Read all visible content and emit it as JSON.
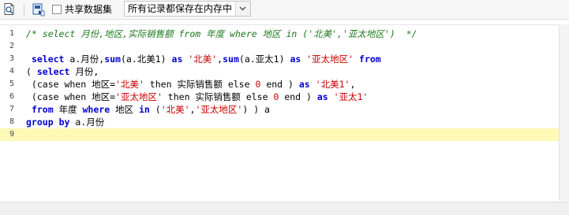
{
  "toolbar": {
    "query_icon": "magnifier-page-icon",
    "export_icon": "export-icon",
    "share_checkbox_label": "共享数据集",
    "share_checked": false,
    "record_mode_value": "所有记录都保存在内存中"
  },
  "editor": {
    "active_line": 9,
    "lines": [
      {
        "n": "1",
        "tokens": [
          {
            "t": "cmt",
            "v": "/* select 月份,地区,实际销售额 from 年度 where 地区 in ('北美','亚太地区')  */"
          }
        ]
      },
      {
        "n": "2",
        "tokens": []
      },
      {
        "n": "3",
        "tokens": [
          {
            "t": "txt",
            "v": " "
          },
          {
            "t": "kw",
            "v": "select"
          },
          {
            "t": "txt",
            "v": " a.月份,"
          },
          {
            "t": "kw",
            "v": "sum"
          },
          {
            "t": "txt",
            "v": "(a.北美1) "
          },
          {
            "t": "kw",
            "v": "as"
          },
          {
            "t": "txt",
            "v": " "
          },
          {
            "t": "str",
            "v": "'北美'"
          },
          {
            "t": "txt",
            "v": ","
          },
          {
            "t": "kw",
            "v": "sum"
          },
          {
            "t": "txt",
            "v": "(a.亚太1) "
          },
          {
            "t": "kw",
            "v": "as"
          },
          {
            "t": "txt",
            "v": " "
          },
          {
            "t": "str",
            "v": "'亚太地区'"
          },
          {
            "t": "txt",
            "v": " "
          },
          {
            "t": "kw",
            "v": "from"
          }
        ]
      },
      {
        "n": "4",
        "tokens": [
          {
            "t": "txt",
            "v": "( "
          },
          {
            "t": "kw",
            "v": "select"
          },
          {
            "t": "txt",
            "v": " 月份,"
          }
        ]
      },
      {
        "n": "5",
        "tokens": [
          {
            "t": "txt",
            "v": " (case when 地区="
          },
          {
            "t": "str",
            "v": "'北美'"
          },
          {
            "t": "txt",
            "v": " then 实际销售额 else "
          },
          {
            "t": "num",
            "v": "0"
          },
          {
            "t": "txt",
            "v": " end ) "
          },
          {
            "t": "kw",
            "v": "as"
          },
          {
            "t": "txt",
            "v": " "
          },
          {
            "t": "str",
            "v": "'北美1'"
          },
          {
            "t": "txt",
            "v": ","
          }
        ]
      },
      {
        "n": "6",
        "tokens": [
          {
            "t": "txt",
            "v": " (case when 地区="
          },
          {
            "t": "str",
            "v": "'亚太地区'"
          },
          {
            "t": "txt",
            "v": " then 实际销售额 else "
          },
          {
            "t": "num",
            "v": "0"
          },
          {
            "t": "txt",
            "v": " end ) "
          },
          {
            "t": "kw",
            "v": "as"
          },
          {
            "t": "txt",
            "v": " "
          },
          {
            "t": "str",
            "v": "'亚太1'"
          }
        ]
      },
      {
        "n": "7",
        "tokens": [
          {
            "t": "txt",
            "v": " "
          },
          {
            "t": "kw",
            "v": "from"
          },
          {
            "t": "txt",
            "v": " 年度 "
          },
          {
            "t": "kw",
            "v": "where"
          },
          {
            "t": "txt",
            "v": " 地区 "
          },
          {
            "t": "kw",
            "v": "in"
          },
          {
            "t": "txt",
            "v": " ("
          },
          {
            "t": "str",
            "v": "'北美'"
          },
          {
            "t": "txt",
            "v": ","
          },
          {
            "t": "str",
            "v": "'亚太地区'"
          },
          {
            "t": "txt",
            "v": ") ) a"
          }
        ]
      },
      {
        "n": "8",
        "tokens": [
          {
            "t": "kw",
            "v": "group"
          },
          {
            "t": "txt",
            "v": " "
          },
          {
            "t": "kw",
            "v": "by"
          },
          {
            "t": "txt",
            "v": " a.月份"
          }
        ]
      },
      {
        "n": "9",
        "tokens": []
      }
    ]
  }
}
